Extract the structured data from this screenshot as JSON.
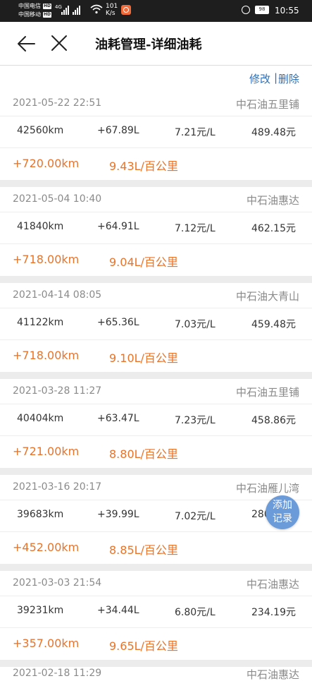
{
  "status_bar": {
    "carrier1": "中国电信",
    "carrier2": "中国移动",
    "hd": "HD",
    "net": "4G",
    "speed_value": "101",
    "speed_unit": "K/s",
    "battery": "98",
    "time": "10:55"
  },
  "header": {
    "title": "油耗管理-详细油耗"
  },
  "actions": {
    "edit": "修改",
    "separator": "|",
    "delete": "删除"
  },
  "records": [
    {
      "date": "2021-05-22 22:51",
      "station": "中石油五里铺",
      "odometer": "42560km",
      "fuel": "+67.89L",
      "price": "7.21元/L",
      "cost": "489.48元",
      "distance": "+720.00km",
      "consumption": "9.43L/百公里"
    },
    {
      "date": "2021-05-04 10:40",
      "station": "中石油惠达",
      "odometer": "41840km",
      "fuel": "+64.91L",
      "price": "7.12元/L",
      "cost": "462.15元",
      "distance": "+718.00km",
      "consumption": "9.04L/百公里"
    },
    {
      "date": "2021-04-14 08:05",
      "station": "中石油大青山",
      "odometer": "41122km",
      "fuel": "+65.36L",
      "price": "7.03元/L",
      "cost": "459.48元",
      "distance": "+718.00km",
      "consumption": "9.10L/百公里"
    },
    {
      "date": "2021-03-28 11:27",
      "station": "中石油五里铺",
      "odometer": "40404km",
      "fuel": "+63.47L",
      "price": "7.23元/L",
      "cost": "458.86元",
      "distance": "+721.00km",
      "consumption": "8.80L/百公里"
    },
    {
      "date": "2021-03-16 20:17",
      "station": "中石油雁儿湾",
      "odometer": "39683km",
      "fuel": "+39.99L",
      "price": "7.02元/L",
      "cost": "280.",
      "distance": "+452.00km",
      "consumption": "8.85L/百公里"
    },
    {
      "date": "2021-03-03 21:54",
      "station": "中石油惠达",
      "odometer": "39231km",
      "fuel": "+34.44L",
      "price": "6.80元/L",
      "cost": "234.19元",
      "distance": "+357.00km",
      "consumption": "9.65L/百公里"
    }
  ],
  "partial_record": {
    "date": "2021-02-18 11:29",
    "station": "中石油惠达"
  },
  "fab": {
    "line1": "添加",
    "line2": "记录"
  }
}
